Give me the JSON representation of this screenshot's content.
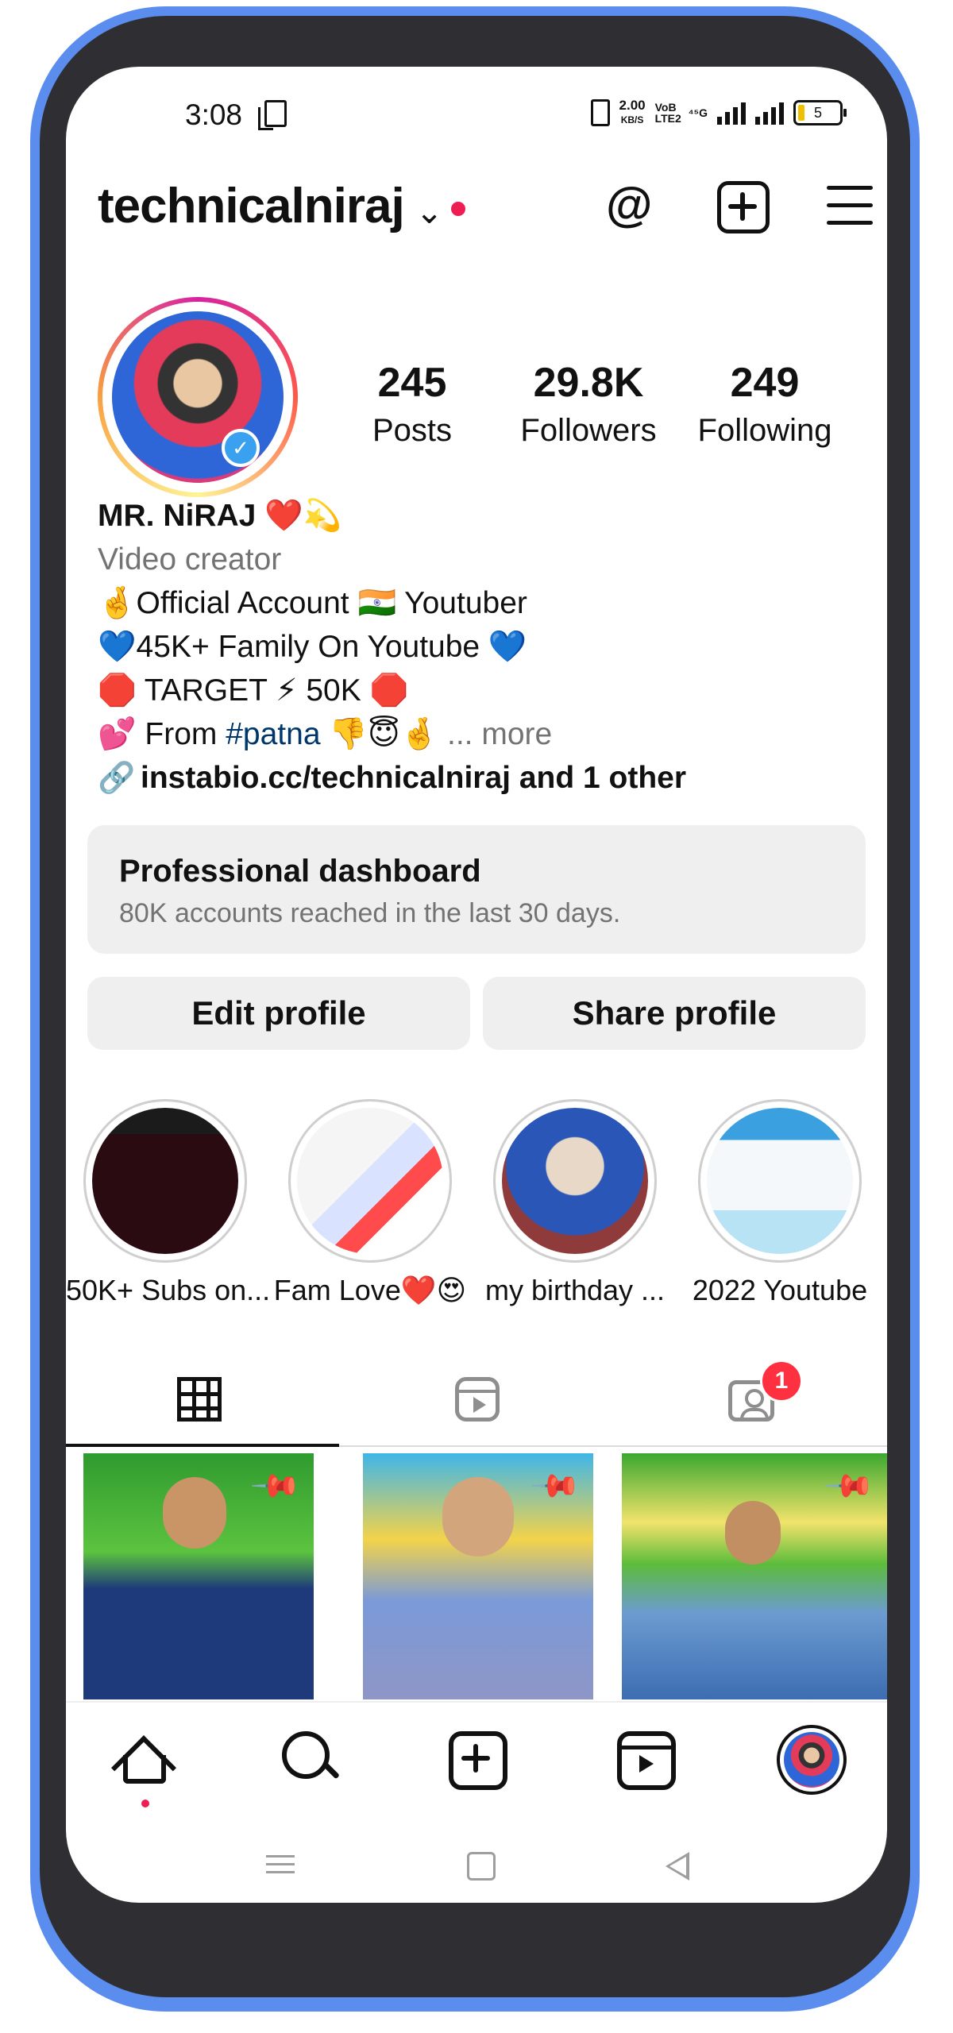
{
  "status_bar": {
    "time": "3:08",
    "net_speed": "2.00",
    "net_unit": "KB/S",
    "volte": "VoB LTE2",
    "signal_tag": "⁴⁵G",
    "battery": "5"
  },
  "header": {
    "username": "technicalniraj",
    "chevron": "⌄",
    "icons": [
      "threads-icon",
      "create-icon",
      "menu-icon"
    ]
  },
  "profile": {
    "stats": [
      {
        "value": "245",
        "label": "Posts"
      },
      {
        "value": "29.8K",
        "label": "Followers"
      },
      {
        "value": "249",
        "label": "Following"
      }
    ],
    "name": "MR. NiRAJ ❤️💫",
    "category": "Video creator",
    "bio_line1": "🤞Official Account 🇮🇳 Youtuber",
    "bio_line2": "💙45K+ Family On Youtube 💙",
    "bio_line3": "🛑 TARGET ⚡ 50K 🛑",
    "bio_line4_prefix": "💕 From ",
    "bio_hashtag": "#patna",
    "bio_line4_suffix": " 👎😇🤞",
    "more": "... more",
    "link": "instabio.cc/technicalniraj and 1 other"
  },
  "dashboard": {
    "title": "Professional dashboard",
    "subtitle": "80K accounts reached in the last 30 days."
  },
  "buttons": {
    "edit": "Edit profile",
    "share": "Share profile"
  },
  "highlights": [
    {
      "label": "50K+ Subs on..."
    },
    {
      "label": "Fam Love❤️😍"
    },
    {
      "label": "my birthday ..."
    },
    {
      "label": "2022 Youtube"
    }
  ],
  "tabs": {
    "tagged_badge": "1"
  },
  "colors": {
    "accent_red": "#ee1d52",
    "hashtag": "#00376b",
    "muted": "#737373",
    "button_bg": "#efefef"
  }
}
